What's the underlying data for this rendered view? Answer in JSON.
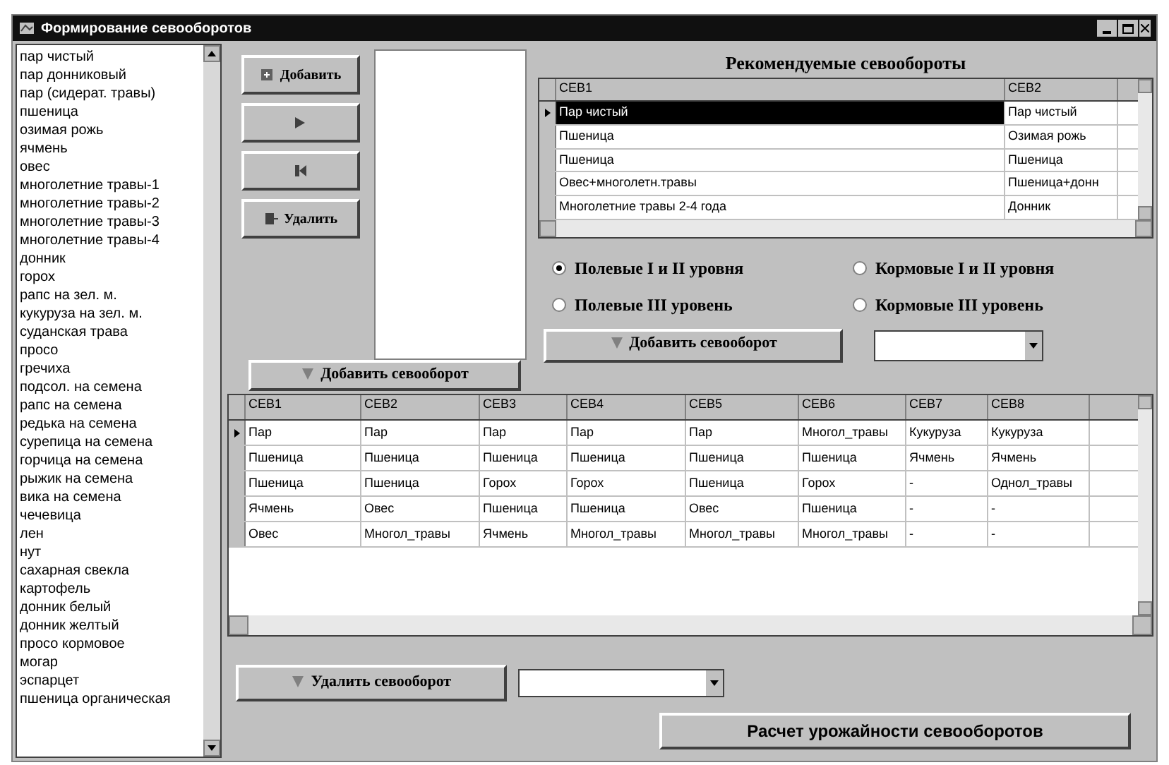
{
  "window": {
    "title": "Формирование севооборотов"
  },
  "crop_list": {
    "items": [
      "пар чистый",
      "пар донниковый",
      "пар (сидерат. травы)",
      "пшеница",
      "озимая рожь",
      "ячмень",
      "овес",
      "многолетние травы-1",
      "многолетние травы-2",
      "многолетние травы-3",
      "многолетние травы-4",
      "донник",
      "горох",
      "рапс на зел. м.",
      "кукуруза на зел. м.",
      "суданская трава",
      "просо",
      "гречиха",
      "подсол. на семена",
      "рапс на семена",
      "редька на семена",
      "сурепица на семена",
      "горчица на семена",
      "рыжик на семена",
      "вика на семена",
      "чечевица",
      "лен",
      "нут",
      "сахарная свекла",
      "картофель",
      "донник белый",
      "донник желтый",
      "просо кормовое",
      "могар",
      "эспарцет",
      "пшеница органическая"
    ]
  },
  "side_buttons": [
    {
      "kind": "add",
      "label": "Добавить"
    },
    {
      "kind": "right"
    },
    {
      "kind": "left"
    },
    {
      "kind": "delete",
      "label": "Удалить"
    }
  ],
  "add_button_left": "Добавить севооборот",
  "recommended": {
    "title": "Рекомендуемые севообороты",
    "columns": [
      "СЕВ1",
      "СЕВ2"
    ],
    "rows": [
      {
        "selected": true,
        "cells": [
          "Пар чистый",
          "Пар чистый"
        ]
      },
      {
        "selected": false,
        "cells": [
          "Пшеница",
          "Озимая рожь"
        ]
      },
      {
        "selected": false,
        "cells": [
          "Пшеница",
          "Пшеница"
        ]
      },
      {
        "selected": false,
        "cells": [
          "Овес+многолетн.травы",
          "Пшеница+донн"
        ]
      },
      {
        "selected": false,
        "cells": [
          "Многолетние травы 2-4 года",
          "Донник"
        ]
      }
    ]
  },
  "levels": [
    {
      "label": "Полевые I и II уровня",
      "selected": true
    },
    {
      "label": "Кормовые I и II уровня",
      "selected": false
    },
    {
      "label": "Полевые III уровень",
      "selected": false
    },
    {
      "label": "Кормовые III уровень",
      "selected": false
    }
  ],
  "add_button_right": "Добавить севооборот",
  "rotations": {
    "columns": [
      "СЕВ1",
      "СЕВ2",
      "СЕВ3",
      "СЕВ4",
      "СЕВ5",
      "СЕВ6",
      "СЕВ7",
      "СЕВ8"
    ],
    "rows": [
      {
        "selected": true,
        "cells": [
          "Пар",
          "Пар",
          "Пар",
          "Пар",
          "Пар",
          "Многол_травы",
          "Кукуруза",
          "Кукуруза"
        ]
      },
      {
        "selected": false,
        "cells": [
          "Пшеница",
          "Пшеница",
          "Пшеница",
          "Пшеница",
          "Пшеница",
          "Пшеница",
          "Ячмень",
          "Ячмень"
        ]
      },
      {
        "selected": false,
        "cells": [
          "Пшеница",
          "Пшеница",
          "Горох",
          "Горох",
          "Пшеница",
          "Горох",
          "-",
          "Однол_травы"
        ]
      },
      {
        "selected": false,
        "cells": [
          "Ячмень",
          "Овес",
          "Пшеница",
          "Пшеница",
          "Овес",
          "Пшеница",
          "-",
          "-"
        ]
      },
      {
        "selected": false,
        "cells": [
          "Овес",
          "Многол_травы",
          "Ячмень",
          "Многол_травы",
          "Многол_травы",
          "Многол_травы",
          "-",
          "-"
        ]
      }
    ]
  },
  "delete_button": "Удалить севооборот",
  "calc_button": "Расчет урожайности севооборотов"
}
